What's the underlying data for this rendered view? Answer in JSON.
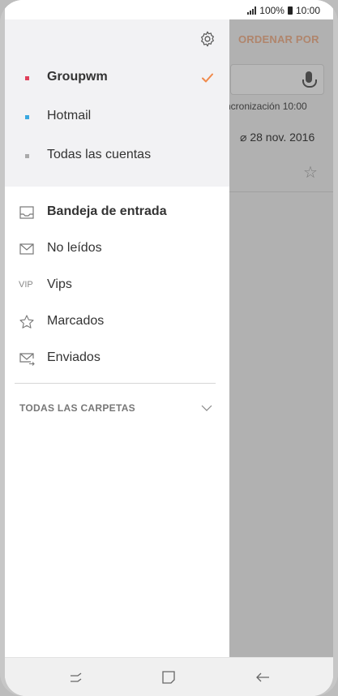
{
  "status_bar": {
    "battery": "100%",
    "time": "10:00"
  },
  "background_app": {
    "sort_label": "ORDENAR POR",
    "sync_text": "ncronización  10:00",
    "date_text": "28 nov. 2016"
  },
  "drawer": {
    "accounts": [
      {
        "label": "Groupwm",
        "color": "#e0405a",
        "selected": true
      },
      {
        "label": "Hotmail",
        "color": "#3aa8e0",
        "selected": false
      },
      {
        "label": "Todas las cuentas",
        "color": "#aaaaaa",
        "selected": false
      }
    ],
    "menu": [
      {
        "label": "Bandeja de entrada",
        "icon": "inbox-icon",
        "bold": true
      },
      {
        "label": "No leídos",
        "icon": "envelope-icon",
        "bold": false
      },
      {
        "label": "Vips",
        "icon_text": "VIP",
        "bold": false
      },
      {
        "label": "Marcados",
        "icon": "star-icon",
        "bold": false
      },
      {
        "label": "Enviados",
        "icon": "sent-icon",
        "bold": false
      }
    ],
    "folders_label": "TODAS LAS CARPETAS"
  },
  "colors": {
    "accent": "#f08a4b",
    "drawer_header_bg": "#f2f2f4",
    "sort_text": "#f4b996"
  }
}
